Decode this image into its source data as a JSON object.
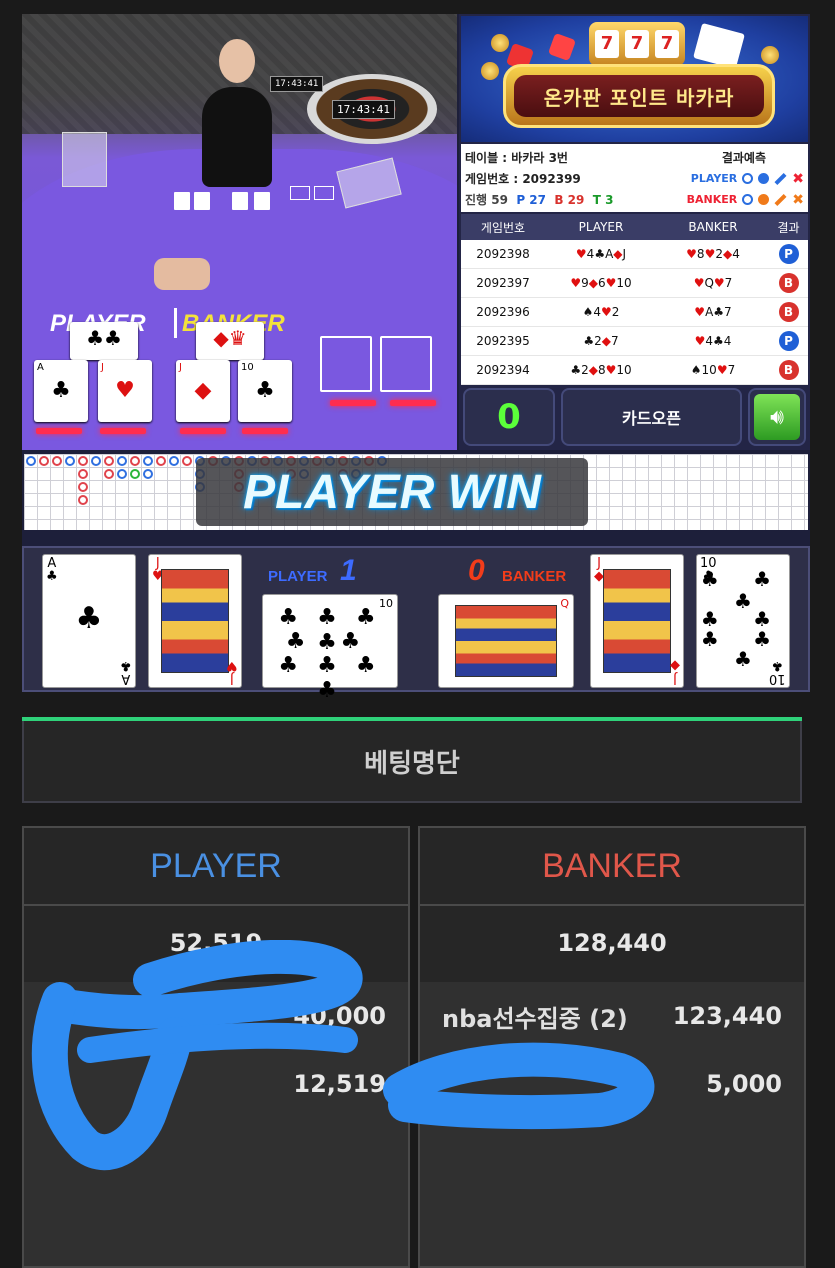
{
  "video": {
    "clock_1": "17:43:41",
    "clock_2": "17:43:41",
    "player_label": "PLAYER",
    "banker_label": "BANKER"
  },
  "banner": {
    "title": "온카판 포인트 바카라",
    "slot_digits": [
      "7",
      "7",
      "7"
    ]
  },
  "table_info": {
    "table_label": "테이블 : 바카라 3번",
    "game_no_label": "게임번호 : 2092399",
    "prediction_label": "결과예측",
    "progress_label": "진행 59",
    "p_count": "P 27",
    "b_count": "B 29",
    "t_count": "T 3",
    "pred_player": "PLAYER",
    "pred_banker": "BANKER"
  },
  "history": {
    "headers": [
      "게임번호",
      "PLAYER",
      "BANKER",
      "결과"
    ],
    "rows": [
      {
        "id": "2092398",
        "player": [
          [
            "♥",
            "4",
            "r"
          ],
          [
            "♣",
            "A",
            "b"
          ],
          [
            "◆",
            "J",
            "r"
          ]
        ],
        "banker": [
          [
            "♥",
            "8",
            "r"
          ],
          [
            "♥",
            "2",
            "r"
          ],
          [
            "◆",
            "4",
            "r"
          ]
        ],
        "result": "P",
        "color": "#1f5fd6"
      },
      {
        "id": "2092397",
        "player": [
          [
            "♥",
            "9",
            "r"
          ],
          [
            "◆",
            "6",
            "r"
          ],
          [
            "♥",
            "10",
            "r"
          ]
        ],
        "banker": [
          [
            "♥",
            "Q",
            "r"
          ],
          [
            "♥",
            "7",
            "r"
          ]
        ],
        "result": "B",
        "color": "#d8322d"
      },
      {
        "id": "2092396",
        "player": [
          [
            "♠",
            "4",
            "b"
          ],
          [
            "♥",
            "2",
            "r"
          ]
        ],
        "banker": [
          [
            "♥",
            "A",
            "r"
          ],
          [
            "♣",
            "7",
            "b"
          ]
        ],
        "result": "B",
        "color": "#d8322d"
      },
      {
        "id": "2092395",
        "player": [
          [
            "♣",
            "2",
            "b"
          ],
          [
            "◆",
            "7",
            "r"
          ]
        ],
        "banker": [
          [
            "♥",
            "4",
            "r"
          ],
          [
            "♣",
            "4",
            "b"
          ]
        ],
        "result": "P",
        "color": "#1f5fd6"
      },
      {
        "id": "2092394",
        "player": [
          [
            "♣",
            "2",
            "b"
          ],
          [
            "◆",
            "8",
            "r"
          ],
          [
            "♥",
            "10",
            "r"
          ]
        ],
        "banker": [
          [
            "♠",
            "10",
            "b"
          ],
          [
            "♥",
            "7",
            "r"
          ]
        ],
        "result": "B",
        "color": "#d8322d"
      }
    ]
  },
  "controls": {
    "score": "0",
    "card_open_label": "카드오픈"
  },
  "win_banner": "PLAYER WIN",
  "result_cards": {
    "player_label": "PLAYER",
    "player_score": "1",
    "banker_label": "BANKER",
    "banker_score": "0",
    "player_cards": [
      {
        "rank": "A",
        "suit": "♣",
        "color": "#000"
      },
      {
        "rank": "J",
        "suit": "♥",
        "color": "#d11"
      },
      {
        "rank": "10",
        "suit": "♣",
        "color": "#000"
      }
    ],
    "banker_cards": [
      {
        "rank": "Q",
        "suit": "◆",
        "color": "#d11"
      },
      {
        "rank": "J",
        "suit": "◆",
        "color": "#d11"
      },
      {
        "rank": "10",
        "suit": "♣",
        "color": "#000"
      }
    ]
  },
  "betting": {
    "title": "베팅명단",
    "player": {
      "header": "PLAYER",
      "header_color": "#4a90e2",
      "total": "52,519",
      "rows": [
        {
          "name": "",
          "amount": "40,000"
        },
        {
          "name": "",
          "amount": "12,519"
        }
      ]
    },
    "banker": {
      "header": "BANKER",
      "header_color": "#e0574a",
      "total": "128,440",
      "rows": [
        {
          "name": "nba선수집중 (2)",
          "amount": "123,440"
        },
        {
          "name": "",
          "amount": "5,000"
        }
      ]
    }
  },
  "colors": {
    "accent_green": "#2fd27a",
    "player_blue": "#4a90e2",
    "banker_red": "#e0574a",
    "scribble_blue": "#2f8cf2"
  }
}
